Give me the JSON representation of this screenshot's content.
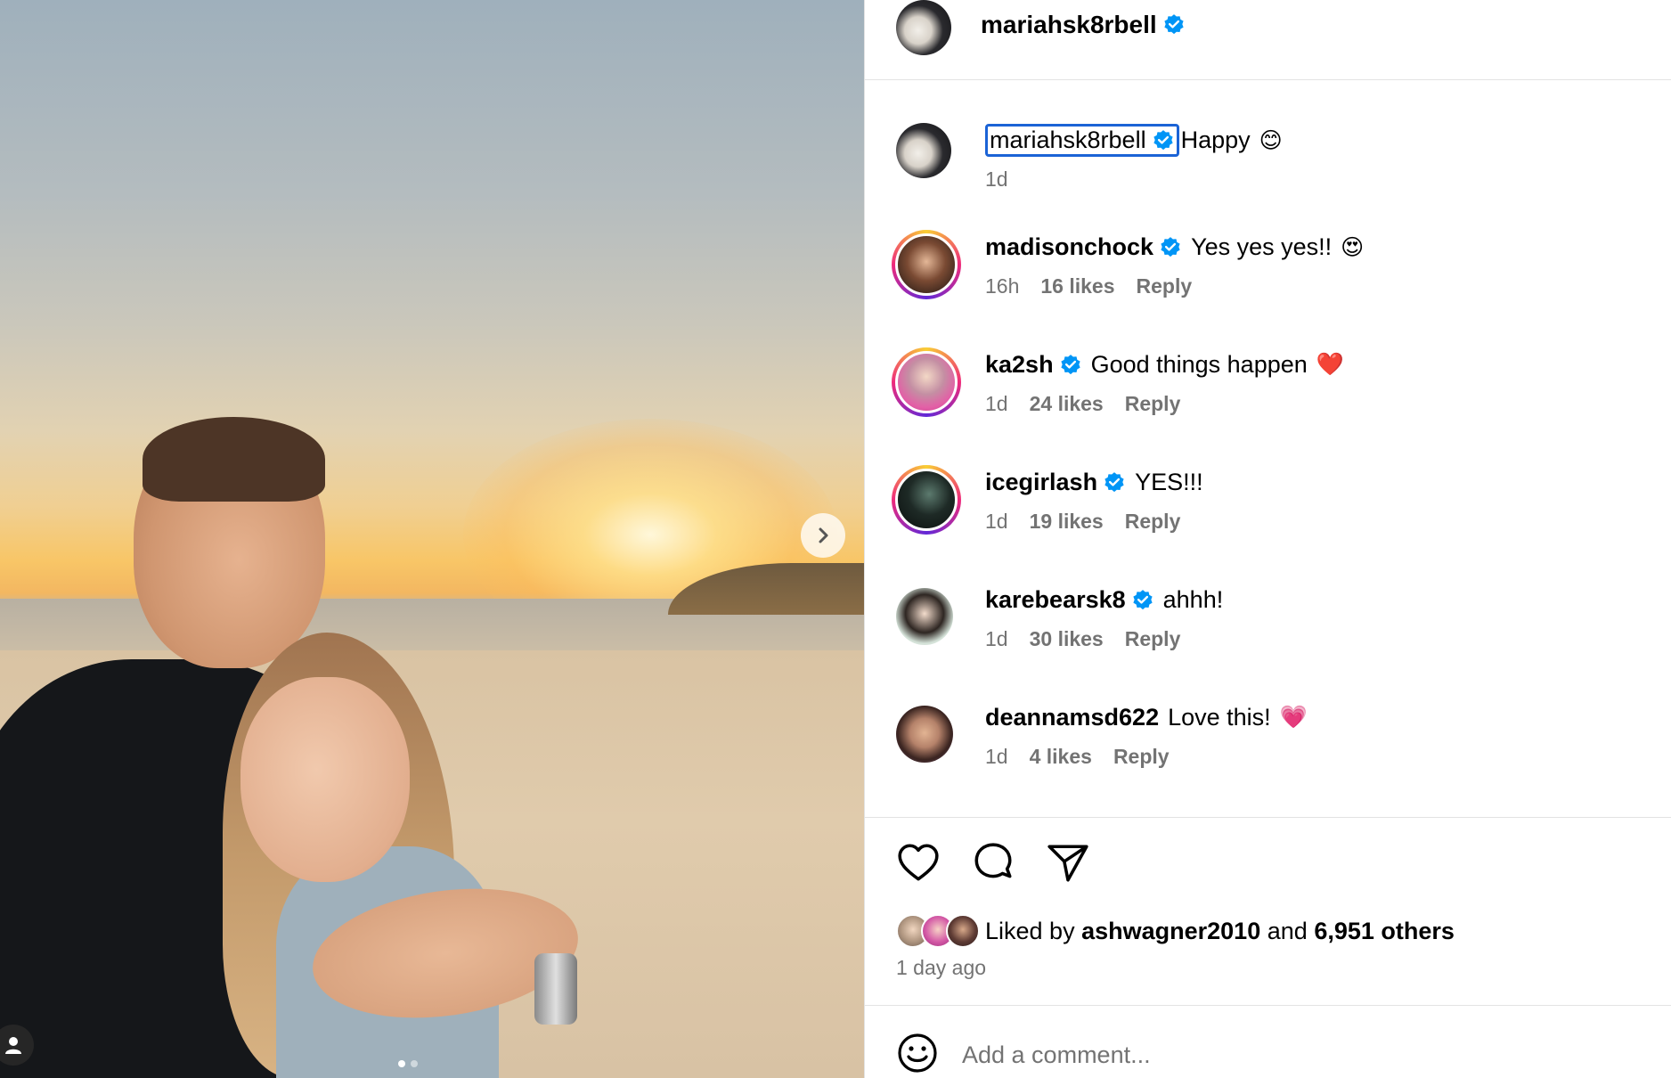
{
  "post": {
    "owner": "mariahsk8rbell",
    "carousel": {
      "total_slides": 2,
      "active_slide": 1
    }
  },
  "caption": {
    "username": "mariahsk8rbell",
    "text": "Happy",
    "emoji": "😊",
    "time": "1d"
  },
  "comments": [
    {
      "username": "madisonchock",
      "verified": true,
      "text": "Yes yes yes!!",
      "emoji": "😍",
      "time": "16h",
      "likes": "16 likes",
      "reply": "Reply"
    },
    {
      "username": "ka2sh",
      "verified": true,
      "text": "Good things happen",
      "emoji": "❤️",
      "time": "1d",
      "likes": "24 likes",
      "reply": "Reply"
    },
    {
      "username": "icegirlash",
      "verified": true,
      "text": "YES!!!",
      "emoji": "",
      "time": "1d",
      "likes": "19 likes",
      "reply": "Reply"
    },
    {
      "username": "karebearsk8",
      "verified": true,
      "text": "ahhh!",
      "emoji": "",
      "time": "1d",
      "likes": "30 likes",
      "reply": "Reply"
    },
    {
      "username": "deannamsd622",
      "verified": false,
      "text": "Love this!",
      "emoji": "💗",
      "time": "1d",
      "likes": "4 likes",
      "reply": "Reply"
    }
  ],
  "likes": {
    "prefix": "Liked by",
    "user": "ashwagner2010",
    "joiner": "and",
    "others": "6,951 others"
  },
  "posted_ago": "1 day ago",
  "add_comment": {
    "placeholder": "Add a comment..."
  },
  "colors": {
    "verified": "#0095f6",
    "focus_ring": "#1b63d6",
    "muted": "#737373"
  }
}
